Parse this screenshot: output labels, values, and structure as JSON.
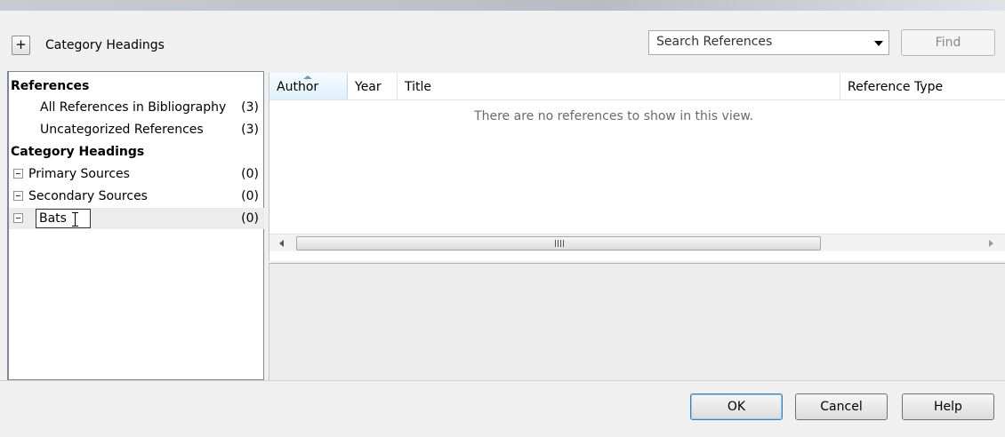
{
  "header": {
    "add_label": "+",
    "title": "Category Headings"
  },
  "search": {
    "placeholder": "Search References",
    "find_label": "Find"
  },
  "left_panel": {
    "references_header": "References",
    "all_refs": {
      "label": "All References in Bibliography",
      "count": "(3)"
    },
    "uncat_refs": {
      "label": "Uncategorized References",
      "count": "(3)"
    },
    "category_header": "Category Headings",
    "categories": [
      {
        "label": "Primary Sources",
        "count": "(0)"
      },
      {
        "label": "Secondary Sources",
        "count": "(0)"
      },
      {
        "label": "Bats",
        "count": "(0)",
        "editing": true
      }
    ]
  },
  "table": {
    "columns": [
      "Author",
      "Year",
      "Title",
      "Reference Type"
    ],
    "sorted_column": "Author",
    "empty_message": "There are no references to show in this view.",
    "scroll_grip": "III"
  },
  "buttons": {
    "ok": "OK",
    "cancel": "Cancel",
    "help": "Help"
  },
  "colors": {
    "sort_header_bg": "#dff0fb",
    "default_button_border": "#3c7fb1"
  }
}
